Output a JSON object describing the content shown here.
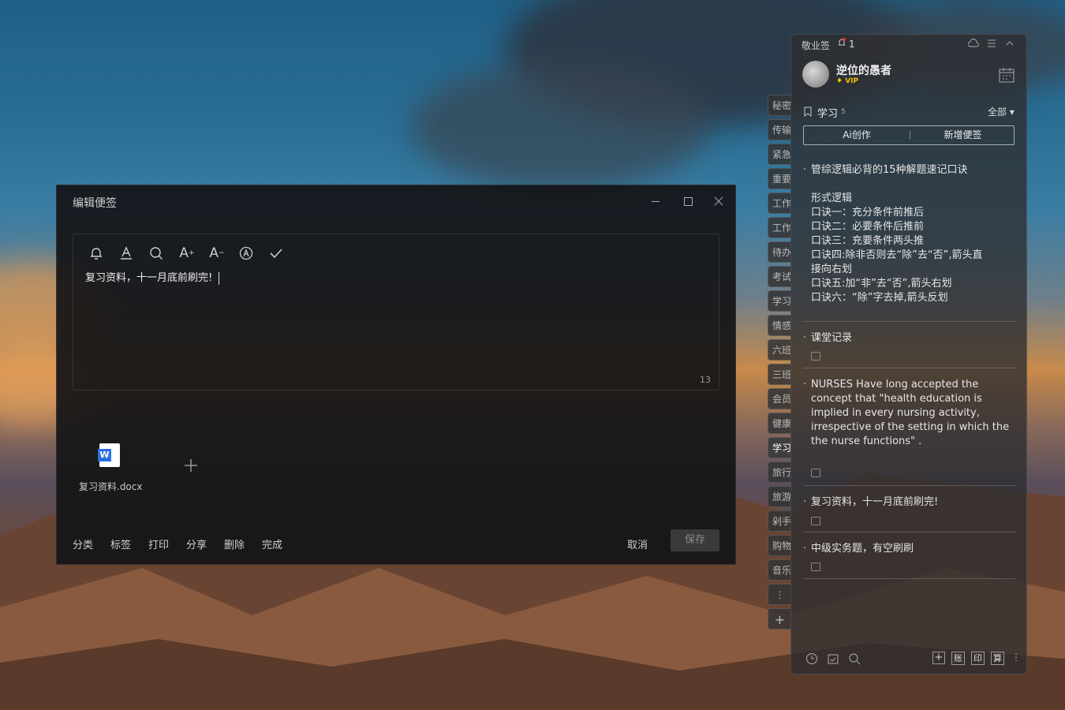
{
  "panel": {
    "app_name": "敬业签",
    "notif_count": "1",
    "user": {
      "name": "逆位的愚者",
      "vip": "VIP"
    },
    "category": {
      "name": "学习",
      "count": "5",
      "filter": "全部"
    },
    "ai_button": "Ai创作",
    "add_button": "新增便签",
    "notes": [
      {
        "title": "管综逻辑必背的15种解题速记口诀",
        "lines": [
          "",
          "形式逻辑",
          "口诀一：充分条件前推后",
          "口诀二：必要条件后推前",
          "口诀三：充要条件两头推",
          "口诀四:除非否则去“除”去“否”,箭头直",
          "接向右划",
          "口诀五:加“非”去“否”,箭头右划",
          "口诀六：“除”字去掉,箭头反划"
        ]
      },
      {
        "title": "课堂记录"
      },
      {
        "title": "NURSES Have long accepted the concept that \"health education is implied in every nursing activity, irrespective of the setting in which the the nurse functions\" ."
      },
      {
        "title": "复习资料，十一月底前刷完!"
      },
      {
        "title": "中级实务题，有空刷刷"
      }
    ],
    "tools": [
      "账",
      "印",
      "算"
    ]
  },
  "tabs": [
    "秘密",
    "传输",
    "紧急",
    "重要",
    "工作",
    "工作",
    "待办",
    "考试",
    "学习",
    "情感",
    "六班",
    "三班",
    "会员",
    "健康",
    "学习",
    "旅行",
    "旅游",
    "剁手",
    "购物",
    "音乐"
  ],
  "editor": {
    "title": "编辑便签",
    "content": "复习资料，十一月底前刷完!",
    "char_count": "13",
    "attachment": "复习资料.docx",
    "attachment_icon": "W",
    "bottom_actions": [
      "分类",
      "标签",
      "打印",
      "分享",
      "删除",
      "完成"
    ],
    "cancel": "取消",
    "save": "保存"
  }
}
